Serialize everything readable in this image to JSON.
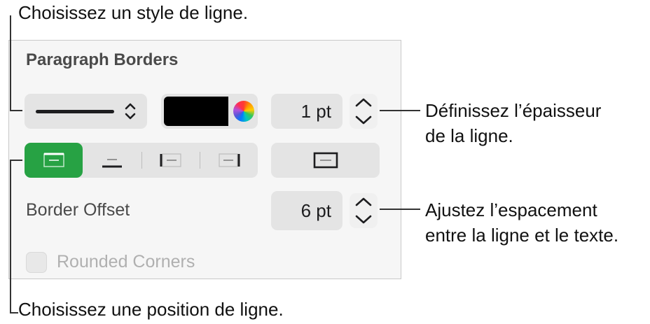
{
  "callouts": {
    "line_style": "Choisissez un style de ligne.",
    "thickness_line1": "Définissez l’épaisseur",
    "thickness_line2": "de la ligne.",
    "spacing_line1": "Ajustez l’espacement",
    "spacing_line2": "entre la ligne et le texte.",
    "position": "Choisissez une position de ligne."
  },
  "panel": {
    "title": "Paragraph Borders",
    "line_style": {
      "icon": "solid-line-icon"
    },
    "color": {
      "value": "#000000",
      "icon": "color-wheel-icon"
    },
    "thickness": {
      "value": "1 pt"
    },
    "positions": [
      {
        "name": "top-border",
        "selected": true
      },
      {
        "name": "bottom-border",
        "selected": false
      },
      {
        "name": "left-border",
        "selected": false
      },
      {
        "name": "right-border",
        "selected": false
      }
    ],
    "box_border": {
      "icon": "box-border-icon"
    },
    "border_offset": {
      "label": "Border Offset",
      "value": "6 pt"
    },
    "rounded_corners": {
      "label": "Rounded Corners",
      "checked": false,
      "enabled": false
    }
  },
  "colors": {
    "accent": "#27a244",
    "control_bg": "#e4e4e4",
    "panel_bg": "#f6f6f6"
  }
}
